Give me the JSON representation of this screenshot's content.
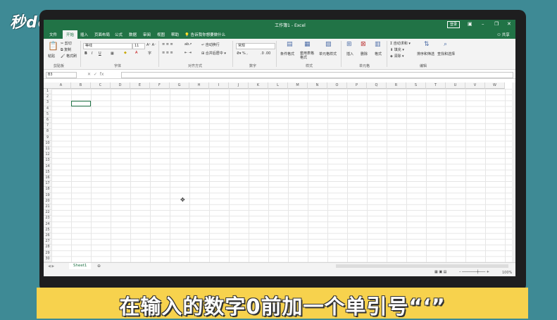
{
  "watermark": "秒dong视频",
  "window": {
    "title": "工作簿1 - Excel",
    "login": "登录"
  },
  "tabs": [
    "文件",
    "开始",
    "插入",
    "页面布局",
    "公式",
    "数据",
    "审阅",
    "视图",
    "帮助"
  ],
  "tell_me": "告诉我你想要做什么",
  "share": "共享",
  "ribbon": {
    "clipboard": {
      "paste": "粘贴",
      "cut": "剪切",
      "copy": "复制",
      "format_painter": "格式刷",
      "group": "剪贴板"
    },
    "font": {
      "name": "等线",
      "size": "11",
      "bold": "B",
      "italic": "I",
      "underline": "U",
      "group": "字体"
    },
    "alignment": {
      "wrap": "自动换行",
      "merge": "合并后居中",
      "group": "对齐方式"
    },
    "number": {
      "format": "常规",
      "group": "数字"
    },
    "styles": {
      "conditional": "条件格式",
      "table": "套用表格格式",
      "cell_styles": "单元格样式",
      "group": "样式"
    },
    "cells": {
      "insert": "插入",
      "delete": "删除",
      "format": "格式",
      "group": "单元格"
    },
    "editing": {
      "autosum": "自动求和",
      "fill": "填充",
      "clear": "清除",
      "sort": "排序和筛选",
      "find": "查找和选择",
      "group": "编辑"
    }
  },
  "formula_bar": {
    "name_box": "B3",
    "fx": "fx"
  },
  "columns": [
    "A",
    "B",
    "C",
    "D",
    "E",
    "F",
    "G",
    "H",
    "I",
    "J",
    "K",
    "L",
    "M",
    "N",
    "O",
    "P",
    "Q",
    "R",
    "S",
    "T",
    "U",
    "V",
    "W"
  ],
  "rows": [
    "1",
    "2",
    "3",
    "4",
    "5",
    "6",
    "7",
    "8",
    "9",
    "10",
    "11",
    "12",
    "13",
    "14",
    "15",
    "16",
    "17",
    "18",
    "19",
    "20",
    "21",
    "22",
    "23",
    "24",
    "25",
    "26",
    "27",
    "28",
    "29",
    "30"
  ],
  "sheet_tab": "Sheet1",
  "zoom": "100%",
  "caption": "在输入的数字0前加一个单引号“‘”"
}
